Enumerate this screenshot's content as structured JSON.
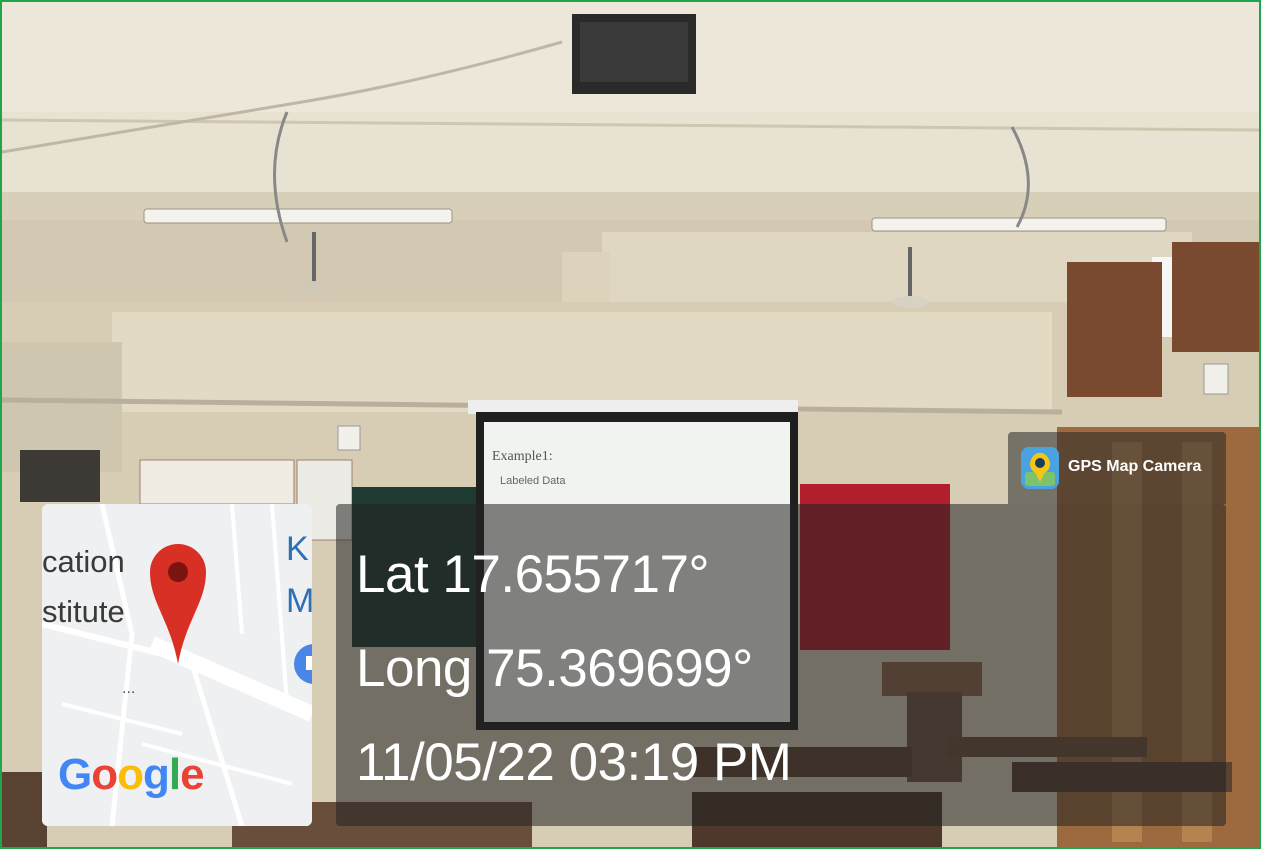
{
  "overlay": {
    "app_badge": {
      "label": "GPS Map Camera",
      "icon": "gps-map-camera-app-icon"
    },
    "latitude": "Lat 17.655717°",
    "longitude": "Long 75.369699°",
    "datetime": "11/05/22 03:19 PM"
  },
  "map": {
    "label_line1": "cation",
    "label_line2": "stitute",
    "side_letters_1": "K",
    "side_letters_2": "M",
    "ellipsis": "...",
    "brand": {
      "g1": "G",
      "o1": "o",
      "o2": "o",
      "g2": "g",
      "l": "l",
      "e": "e"
    },
    "pin_icon": "red-location-pin-icon"
  },
  "projector_screen": {
    "title": "Example1:",
    "subtitle": "Labeled Data"
  },
  "colors": {
    "frame_border": "#1fa64a",
    "pin_red": "#d93025",
    "google_blue": "#4285F4",
    "google_red": "#EA4335",
    "google_yellow": "#FBBC05",
    "google_green": "#34A853"
  }
}
